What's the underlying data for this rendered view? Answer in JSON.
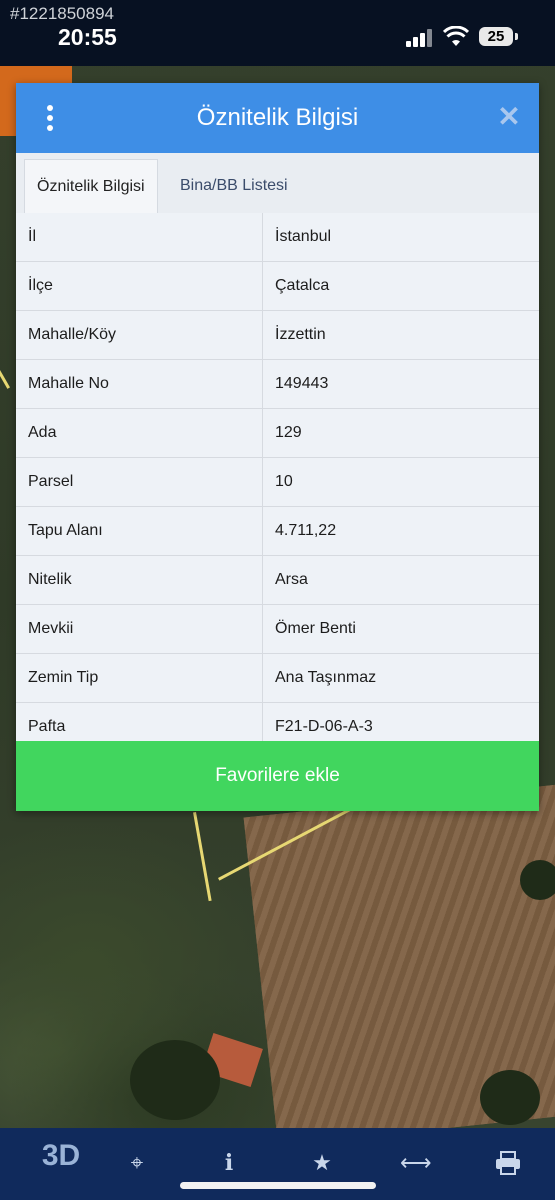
{
  "status_bar": {
    "listing_id": "#1221850894",
    "time": "20:55",
    "battery": "25"
  },
  "modal": {
    "title": "Öznitelik Bilgisi",
    "tabs": [
      {
        "label": "Öznitelik Bilgisi",
        "active": true
      },
      {
        "label": "Bina/BB Listesi",
        "active": false
      }
    ],
    "rows": [
      {
        "key": "İl",
        "value": "İstanbul"
      },
      {
        "key": "İlçe",
        "value": "Çatalca"
      },
      {
        "key": "Mahalle/Köy",
        "value": "İzzettin"
      },
      {
        "key": "Mahalle No",
        "value": "149443"
      },
      {
        "key": "Ada",
        "value": "129"
      },
      {
        "key": "Parsel",
        "value": "10"
      },
      {
        "key": "Tapu Alanı",
        "value": "4.711,22"
      },
      {
        "key": "Nitelik",
        "value": "Arsa"
      },
      {
        "key": "Mevkii",
        "value": "Ömer Benti"
      },
      {
        "key": "Zemin Tip",
        "value": "Ana Taşınmaz"
      },
      {
        "key": "Pafta",
        "value": "F21-D-06-A-3"
      }
    ],
    "favorite_button": "Favorilere ekle"
  },
  "toolbar": {
    "logo": "3D",
    "icons": [
      "crosshair-icon",
      "info-icon",
      "star-icon",
      "arrows-horizontal-icon",
      "printer-icon"
    ]
  },
  "colors": {
    "header_blue": "#3e8ee6",
    "favorite_green": "#41d65e",
    "bottom_bar": "#102a5c"
  }
}
